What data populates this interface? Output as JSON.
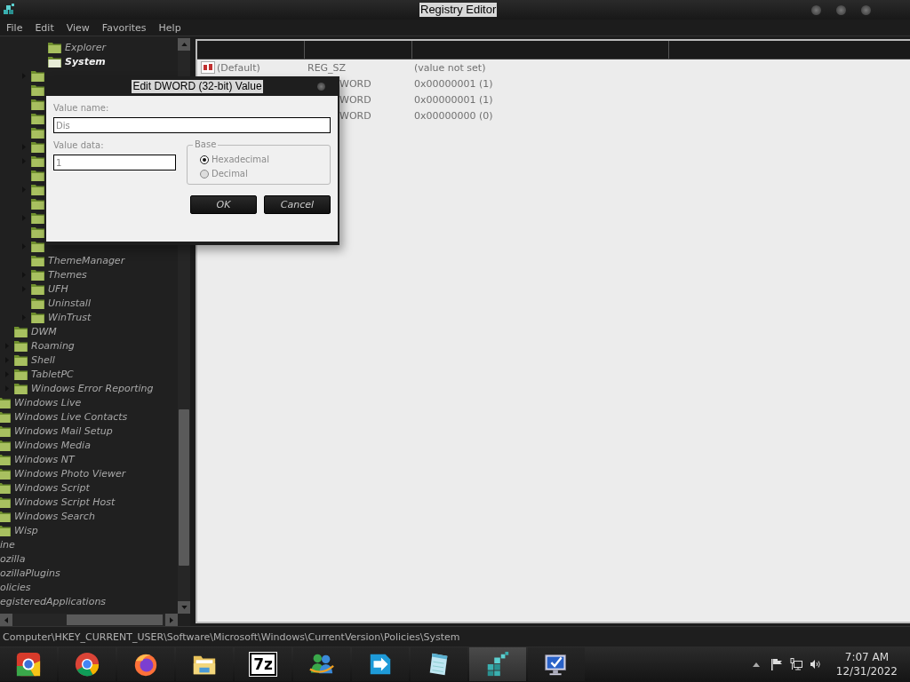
{
  "window": {
    "title": "Registry Editor"
  },
  "menu": [
    "File",
    "Edit",
    "View",
    "Favorites",
    "Help"
  ],
  "tree": {
    "items": [
      {
        "children": [
          {
            "children": [
              {
                "children": [
                  {
                    "children": [
                      {
                        "label": "Explorer",
                        "expandable": false,
                        "selected": false
                      },
                      {
                        "label": "System",
                        "expandable": false,
                        "selected": true
                      }
                    ]
                  },
                  {
                    "expandable": true
                  },
                  {
                    "expandable": false
                  },
                  {
                    "expandable": false
                  },
                  {
                    "expandable": false
                  },
                  {
                    "expandable": false
                  },
                  {
                    "expandable": true
                  },
                  {
                    "expandable": true
                  },
                  {
                    "expandable": false
                  },
                  {
                    "expandable": true
                  },
                  {
                    "expandable": false
                  },
                  {
                    "expandable": true
                  },
                  {
                    "expandable": false
                  },
                  {
                    "expandable": true
                  },
                  {
                    "label": "ThemeManager",
                    "expandable": false,
                    "selected": false
                  },
                  {
                    "label": "Themes",
                    "expandable": true,
                    "selected": false
                  },
                  {
                    "label": "UFH",
                    "expandable": true,
                    "selected": false
                  },
                  {
                    "label": "Uninstall",
                    "expandable": false,
                    "selected": false
                  },
                  {
                    "label": "WinTrust",
                    "expandable": true,
                    "selected": false
                  }
                ]
              },
              {
                "label": "DWM",
                "expandable": false,
                "selected": false
              },
              {
                "label": "Roaming",
                "expandable": true,
                "selected": false
              },
              {
                "label": "Shell",
                "expandable": true,
                "selected": false
              },
              {
                "label": "TabletPC",
                "expandable": true,
                "selected": false
              },
              {
                "label": "Windows Error Reporting",
                "expandable": true,
                "selected": false
              }
            ]
          },
          {
            "label": "Windows Live",
            "selected": false
          },
          {
            "label": "Windows Live Contacts",
            "selected": false
          },
          {
            "label": "Windows Mail Setup",
            "selected": false
          },
          {
            "label": "Windows Media",
            "selected": false
          },
          {
            "label": "Windows NT",
            "selected": false
          },
          {
            "label": "Windows Photo Viewer",
            "selected": false
          },
          {
            "label": "Windows Script",
            "selected": false
          },
          {
            "label": "Windows Script Host",
            "selected": false
          },
          {
            "label": "Windows Search",
            "selected": false
          },
          {
            "label": "Wisp",
            "selected": false
          }
        ]
      },
      {
        "label": "ine",
        "selected": false
      },
      {
        "label": "ozilla",
        "selected": false
      },
      {
        "label": "ozillaPlugins",
        "selected": false
      },
      {
        "label": "olicies",
        "selected": false
      },
      {
        "label": "egisteredApplications",
        "selected": false
      }
    ]
  },
  "values": {
    "rows": [
      {
        "kind": "string",
        "name": "(Default)",
        "type": "REG_SZ",
        "data": "(value not set)"
      },
      {
        "kind": "dword",
        "type": "WORD",
        "data": "0x00000001 (1)"
      },
      {
        "kind": "dword",
        "type": "WORD",
        "data": "0x00000001 (1)"
      },
      {
        "kind": "dword",
        "type": "WORD",
        "data": "0x00000000 (0)"
      }
    ]
  },
  "dialog": {
    "title": "Edit DWORD (32-bit) Value",
    "value_name_label": "Value name:",
    "value_name": "Dis",
    "value_data_label": "Value data:",
    "value_data": "1",
    "base_label": "Base",
    "base_options": [
      {
        "label": "Hexadecimal",
        "selected": true
      },
      {
        "label": "Decimal",
        "selected": false
      }
    ],
    "buttons": [
      "OK",
      "Cancel"
    ]
  },
  "status_bar": "Computer\\HKEY_CURRENT_USER\\Software\\Microsoft\\Windows\\CurrentVersion\\Policies\\System",
  "taskbar": {
    "apps": [
      {
        "kind": "chrome-old",
        "selected": false
      },
      {
        "kind": "chrome",
        "selected": false
      },
      {
        "kind": "firefox",
        "selected": false
      },
      {
        "kind": "explorer",
        "selected": false
      },
      {
        "kind": "text-logo",
        "text": "7z",
        "selected": false
      },
      {
        "kind": "people",
        "selected": false
      },
      {
        "kind": "arrow",
        "selected": false
      },
      {
        "kind": "notepad",
        "selected": false
      },
      {
        "kind": "cubes",
        "selected": true
      },
      {
        "kind": "monitor",
        "selected": false
      }
    ],
    "time": "7:07 AM",
    "date": "12/31/2022"
  }
}
